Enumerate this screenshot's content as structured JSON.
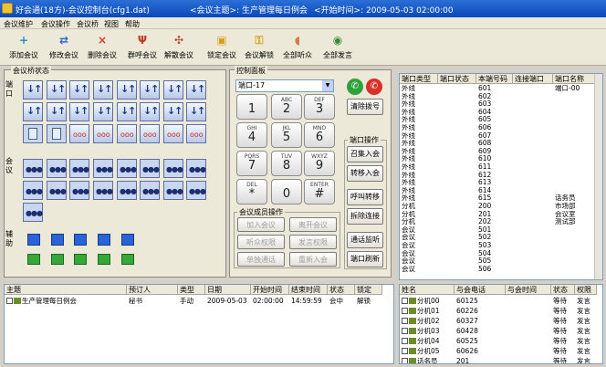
{
  "window": {
    "title": "好会通(18方)-会议控制台(cfg1.dat)",
    "topic_label": "<会议主题>: 生产管理每日例会",
    "start_label": "<开始时间>: 2009-05-03 02:00:00"
  },
  "menu": [
    "会议维护",
    "会议操作",
    "会议桥",
    "视图",
    "帮助"
  ],
  "toolbar": [
    {
      "label": "添加会议",
      "icon": "add-icon",
      "glyph": "+",
      "color": "#2e8bd6"
    },
    {
      "label": "修改会议",
      "icon": "refresh-icon",
      "glyph": "⇄",
      "color": "#2e6ad6"
    },
    {
      "label": "删除会议",
      "icon": "delete-icon",
      "glyph": "×",
      "color": "#d83a2a"
    },
    {
      "label": "群呼会议",
      "icon": "group-call-icon",
      "glyph": "Ψ",
      "color": "#c0402a"
    },
    {
      "label": "解散会议",
      "icon": "dissolve-icon",
      "glyph": "✣",
      "color": "#c0402a"
    },
    {
      "label": "锁定会议",
      "icon": "lock-icon",
      "glyph": "▣",
      "color": "#d8a020"
    },
    {
      "label": "会议解锁",
      "icon": "unlock-icon",
      "glyph": "⚿",
      "color": "#d8a020"
    },
    {
      "label": "全部听众",
      "icon": "ear-icon",
      "glyph": "◖",
      "color": "#d87a4a"
    },
    {
      "label": "全部发言",
      "icon": "speak-icon",
      "glyph": "◉",
      "color": "#3a8a3a"
    }
  ],
  "port_panel": {
    "title": "会议桥状态",
    "side_port": "端口",
    "side_conf": "会议",
    "side_aux": "辅助"
  },
  "control_panel": {
    "title": "控制面板",
    "port_select": "端口-17",
    "clear_label": "清除拨号",
    "keys": [
      {
        "sub": "",
        "main": "1"
      },
      {
        "sub": "ABC",
        "main": "2"
      },
      {
        "sub": "DEF",
        "main": "3"
      },
      {
        "sub": "GHI",
        "main": "4"
      },
      {
        "sub": "JKL",
        "main": "5"
      },
      {
        "sub": "MNO",
        "main": "6"
      },
      {
        "sub": "PQRS",
        "main": "7"
      },
      {
        "sub": "TUV",
        "main": "8"
      },
      {
        "sub": "WXYZ",
        "main": "9"
      },
      {
        "sub": "DEL",
        "main": "*"
      },
      {
        "sub": "",
        "main": "0"
      },
      {
        "sub": "ENTER",
        "main": "#"
      }
    ],
    "port_ops_title": "端口操作",
    "port_ops": [
      "召集入会",
      "转移入会",
      "呼叫转移",
      "拆除连接",
      "通话监听",
      "端口刷新"
    ],
    "member_ops_title": "会议成员操作",
    "member_ops": [
      "加入会议",
      "离开会议",
      "听众权限",
      "发言权限",
      "单独通话",
      "重新入会"
    ]
  },
  "port_table": {
    "headers": [
      "端口类型",
      "端口状态",
      "本端号码",
      "连接端口",
      "端口名称"
    ],
    "rows": [
      [
        "外线",
        "",
        "601",
        "",
        "端口-00"
      ],
      [
        "外线",
        "",
        "602",
        "",
        ""
      ],
      [
        "外线",
        "",
        "603",
        "",
        ""
      ],
      [
        "外线",
        "",
        "604",
        "",
        ""
      ],
      [
        "外线",
        "",
        "605",
        "",
        ""
      ],
      [
        "外线",
        "",
        "606",
        "",
        ""
      ],
      [
        "外线",
        "",
        "607",
        "",
        ""
      ],
      [
        "外线",
        "",
        "608",
        "",
        ""
      ],
      [
        "外线",
        "",
        "609",
        "",
        ""
      ],
      [
        "外线",
        "",
        "610",
        "",
        ""
      ],
      [
        "外线",
        "",
        "611",
        "",
        ""
      ],
      [
        "外线",
        "",
        "612",
        "",
        ""
      ],
      [
        "外线",
        "",
        "613",
        "",
        ""
      ],
      [
        "外线",
        "",
        "614",
        "",
        ""
      ],
      [
        "外线",
        "",
        "615",
        "",
        "话务员"
      ],
      [
        "分机",
        "",
        "200",
        "",
        "市场部"
      ],
      [
        "分机",
        "",
        "201",
        "",
        "会议室"
      ],
      [
        "分机",
        "",
        "202",
        "",
        "测试部"
      ],
      [
        "会议",
        "",
        "501",
        "",
        ""
      ],
      [
        "会议",
        "",
        "502",
        "",
        ""
      ],
      [
        "会议",
        "",
        "503",
        "",
        ""
      ],
      [
        "会议",
        "",
        "504",
        "",
        ""
      ],
      [
        "会议",
        "",
        "505",
        "",
        ""
      ],
      [
        "会议",
        "",
        "506",
        "",
        ""
      ]
    ]
  },
  "meeting_table": {
    "headers": [
      "主题",
      "预订人",
      "类型",
      "日期",
      "开始时间",
      "结束时间",
      "状态",
      "锁定"
    ],
    "rows": [
      [
        "生产管理每日例会",
        "秘书",
        "手动",
        "2009-05-03",
        "02:00:00",
        "14:59:59",
        "会中",
        "解锁"
      ]
    ]
  },
  "member_table": {
    "headers": [
      "姓名",
      "与会电话",
      "与会时间",
      "状态",
      "权限"
    ],
    "rows": [
      [
        "分机00",
        "60125",
        "",
        "等待",
        "发言"
      ],
      [
        "分机01",
        "60226",
        "",
        "等待",
        "发言"
      ],
      [
        "分机02",
        "60327",
        "",
        "等待",
        "发言"
      ],
      [
        "分机03",
        "60428",
        "",
        "等待",
        "发言"
      ],
      [
        "分机04",
        "60525",
        "",
        "等待",
        "发言"
      ],
      [
        "分机05",
        "60626",
        "",
        "等待",
        "发言"
      ],
      [
        "话务员",
        "201",
        "",
        "等待",
        "发言"
      ]
    ]
  }
}
